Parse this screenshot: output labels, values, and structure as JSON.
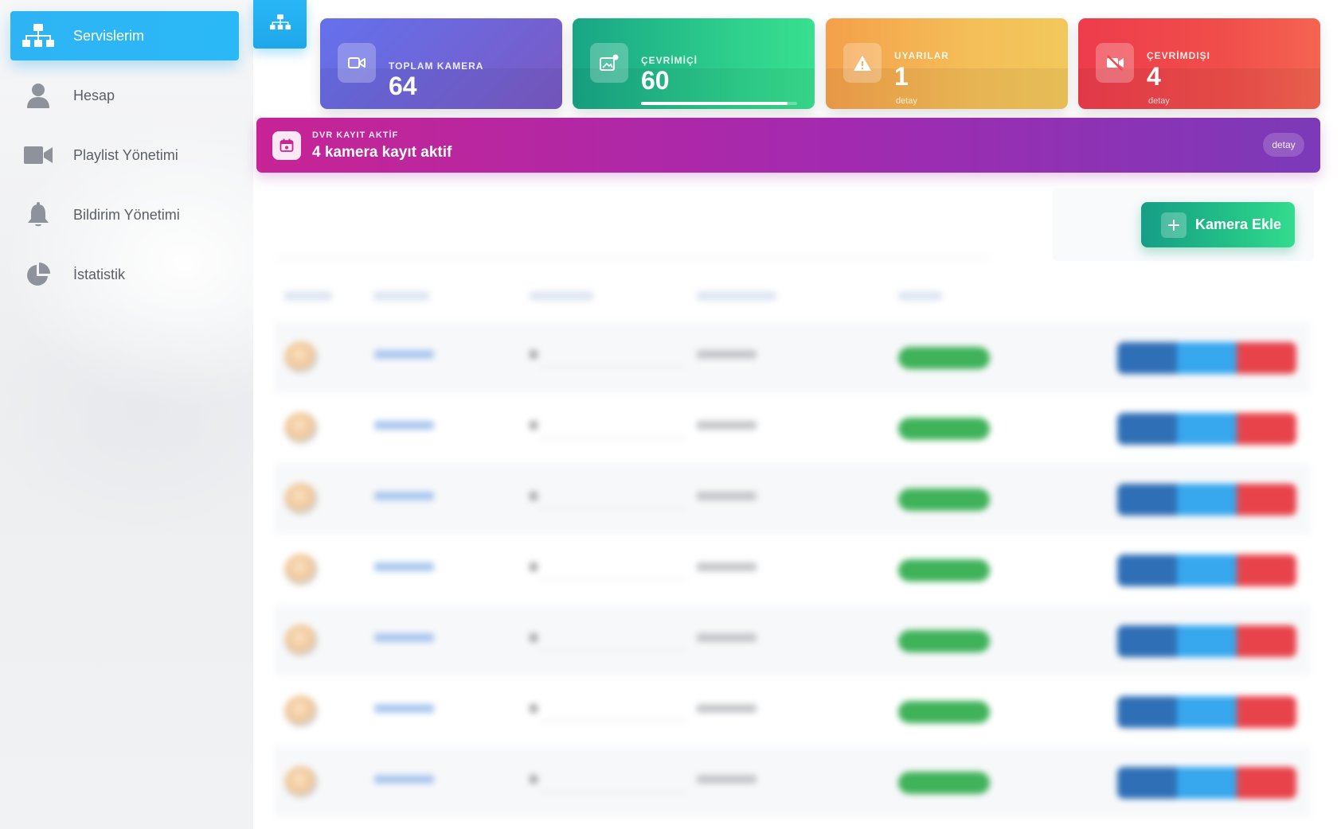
{
  "sidebar": {
    "items": [
      {
        "label": "Servislerim",
        "icon": "sitemap-icon",
        "active": true
      },
      {
        "label": "Hesap",
        "icon": "user-icon",
        "active": false
      },
      {
        "label": "Playlist Yönetimi",
        "icon": "video-camera-icon",
        "active": false
      },
      {
        "label": "Bildirim Yönetimi",
        "icon": "bell-icon",
        "active": false
      },
      {
        "label": "İstatistik",
        "icon": "pie-chart-icon",
        "active": false
      }
    ]
  },
  "toolbar": {
    "toggle_icon": "sitemap-icon"
  },
  "stats": {
    "total": {
      "title": "TOPLAM KAMERA",
      "value": "64",
      "icon": "video-camera-icon",
      "color": "#6a67dc"
    },
    "online": {
      "title": "ÇEVRİMİÇİ",
      "value": "60",
      "progress": 0.94,
      "icon": "camera-online-icon",
      "color": "#22c08a"
    },
    "warnings": {
      "title": "UYARILAR",
      "value": "1",
      "detail": "detay",
      "icon": "warning-icon",
      "color": "#f4b050"
    },
    "offline": {
      "title": "ÇEVRİMDIŞI",
      "value": "4",
      "detail": "detay",
      "icon": "video-off-icon",
      "color": "#f0484b"
    }
  },
  "dvr": {
    "title": "DVR KAYIT AKTİF",
    "text": "4 kamera kayıt aktif",
    "button": "detay",
    "icon": "calendar-icon"
  },
  "actions": {
    "add_camera": "Kamera Ekle"
  },
  "colors": {
    "accent": "#2bb5f5",
    "status_online": "#3fb25a",
    "action_primary": "#2f6fb6",
    "action_info": "#37a7ee",
    "action_danger": "#e8434b"
  }
}
